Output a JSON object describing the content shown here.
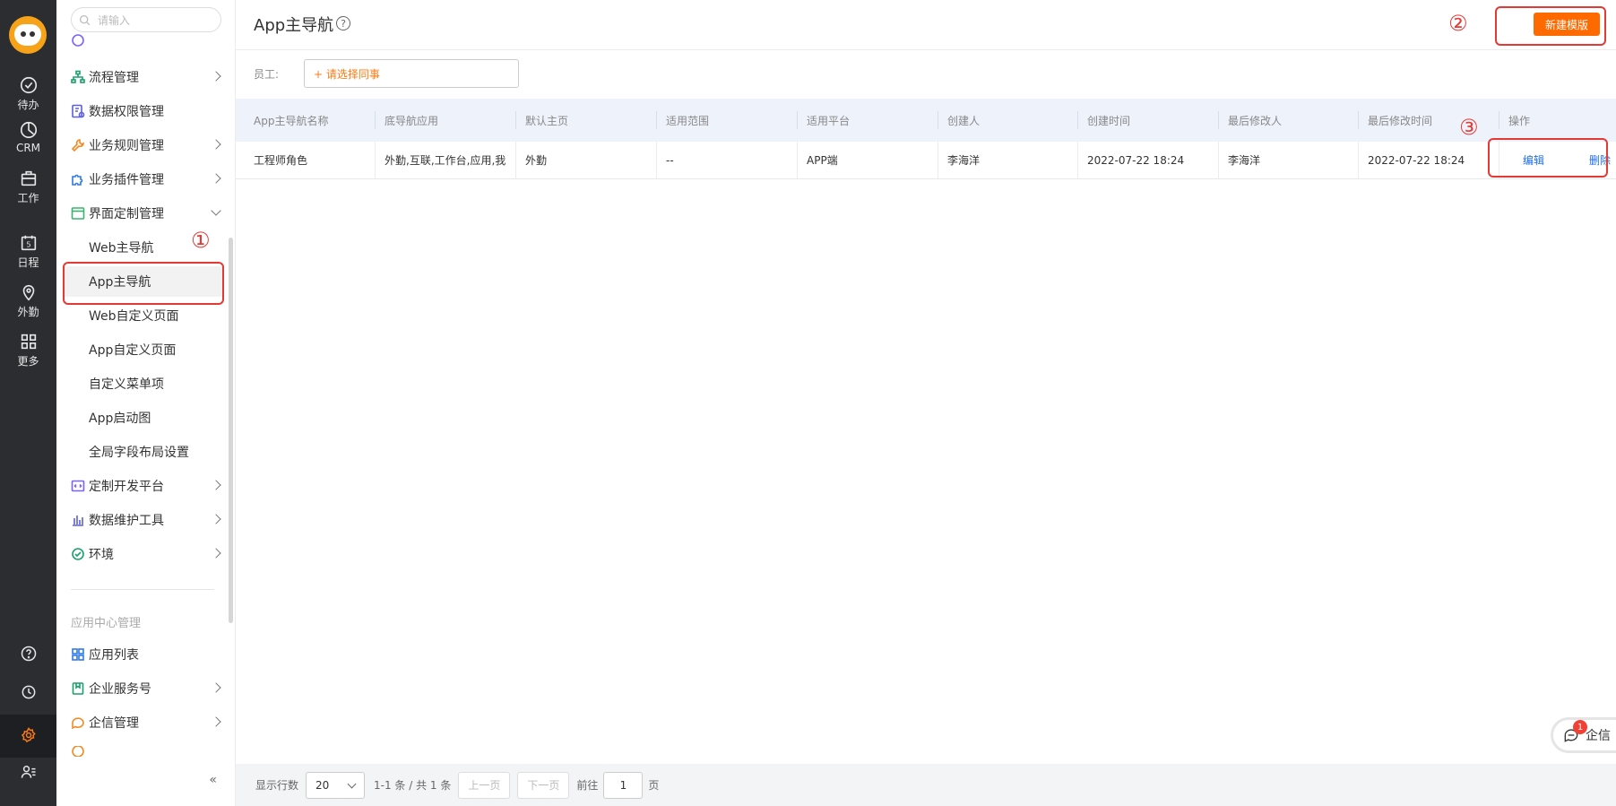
{
  "rail": {
    "items": [
      {
        "label": "待办",
        "icon": "check-circle-icon"
      },
      {
        "label": "CRM",
        "icon": "pie-chart-icon"
      },
      {
        "label": "工作",
        "icon": "briefcase-icon"
      },
      {
        "label": "日程",
        "icon": "calendar-icon",
        "day": "5"
      },
      {
        "label": "外勤",
        "icon": "location-pin-icon"
      },
      {
        "label": "更多",
        "icon": "grid-icon"
      }
    ]
  },
  "sidebar": {
    "search_placeholder": "请输入",
    "items": [
      {
        "label": "流程管理"
      },
      {
        "label": "数据权限管理"
      },
      {
        "label": "业务规则管理"
      },
      {
        "label": "业务插件管理"
      },
      {
        "label": "界面定制管理"
      }
    ],
    "sub_items": [
      {
        "label": "Web主导航"
      },
      {
        "label": "App主导航"
      },
      {
        "label": "Web自定义页面"
      },
      {
        "label": "App自定义页面"
      },
      {
        "label": "自定义菜单项"
      },
      {
        "label": "App启动图"
      },
      {
        "label": "全局字段布局设置"
      }
    ],
    "items2": [
      {
        "label": "定制开发平台"
      },
      {
        "label": "数据维护工具"
      },
      {
        "label": "环境"
      }
    ],
    "group_title": "应用中心管理",
    "items3": [
      {
        "label": "应用列表"
      },
      {
        "label": "企业服务号"
      },
      {
        "label": "企信管理"
      }
    ],
    "collapse_label": "«"
  },
  "header": {
    "title": "App主导航",
    "help": "?",
    "new_button": "新建模版"
  },
  "filter": {
    "label": "员工:",
    "picker": "+ 请选择同事"
  },
  "table": {
    "columns": [
      "App主导航名称",
      "底导航应用",
      "默认主页",
      "适用范围",
      "适用平台",
      "创建人",
      "创建时间",
      "最后修改人",
      "最后修改时间",
      "操作"
    ],
    "rows": [
      {
        "name": "工程师角色",
        "bottom_apps": "外勤,互联,工作台,应用,我",
        "home": "外勤",
        "scope": "--",
        "platform": "APP端",
        "creator": "李海洋",
        "created": "2022-07-22 18:24",
        "modifier": "李海洋",
        "modified": "2022-07-22 18:24",
        "edit": "编辑",
        "delete": "删除"
      }
    ]
  },
  "markers": {
    "m1": "①",
    "m2": "②",
    "m3": "③"
  },
  "footer": {
    "rows_label": "显示行数",
    "rows_value": "20",
    "summary": "1-1 条 / 共 1 条",
    "prev": "上一页",
    "next": "下一页",
    "goto": "前往",
    "page_value": "1",
    "page_suffix": "页"
  },
  "chat": {
    "label": "企信",
    "badge": "1"
  },
  "colors": {
    "accent": "#ff6a00",
    "link": "#1e6ee8",
    "annotation": "#e53935",
    "rail": "#2b2d31"
  }
}
